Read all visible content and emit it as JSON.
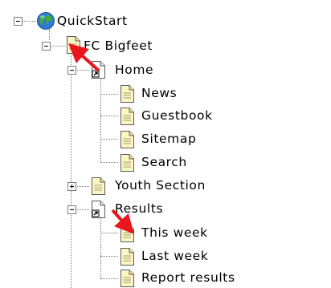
{
  "tree": {
    "root": {
      "label": "QuickStart",
      "icon": "globe-icon",
      "expanded": true
    },
    "site": {
      "label": "FC Bigfeet",
      "icon": "page-icon",
      "expanded": true
    },
    "home": {
      "label": "Home",
      "icon": "shortcut-page-icon",
      "expanded": true,
      "children": [
        "News",
        "Guestbook",
        "Sitemap",
        "Search"
      ]
    },
    "youth": {
      "label": "Youth Section",
      "icon": "page-icon",
      "expanded": false
    },
    "results": {
      "label": "Results",
      "icon": "shortcut-page-icon",
      "expanded": true,
      "children": [
        "This week",
        "Last week",
        "Report results"
      ]
    }
  },
  "annotations": {
    "arrow_color": "#e8161d"
  }
}
